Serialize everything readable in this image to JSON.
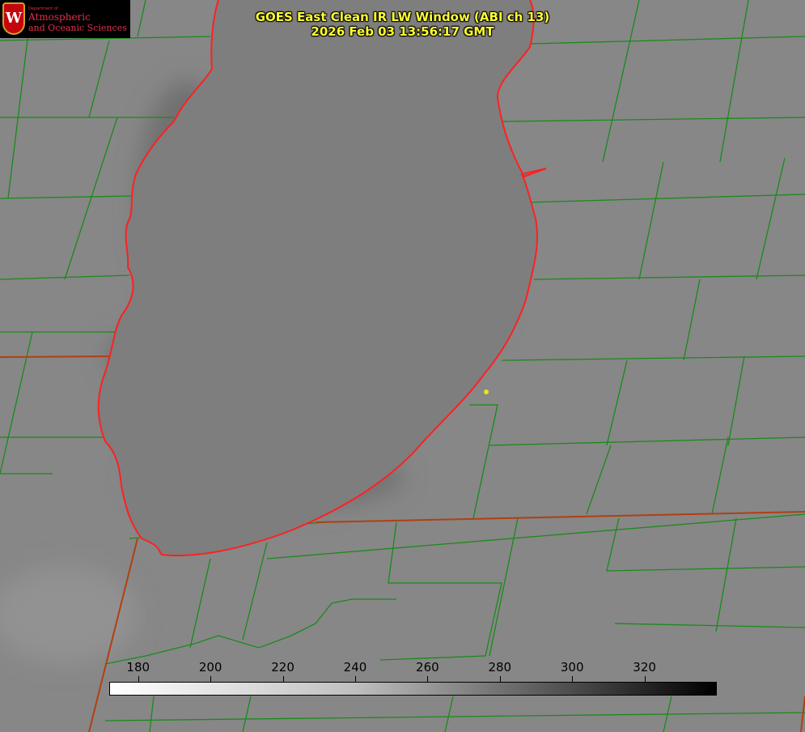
{
  "title": {
    "line1": "GOES East Clean IR LW Window (ABI ch 13)",
    "line2": "2026 Feb 03 13:56:17 GMT"
  },
  "logo": {
    "dept": "Department of",
    "line1": "Atmospheric",
    "line2": "and Oceanic Sciences",
    "mark": "W"
  },
  "colorbar": {
    "ticks": [
      "180",
      "200",
      "220",
      "240",
      "260",
      "280",
      "300",
      "320"
    ],
    "tick_values": [
      180,
      200,
      220,
      240,
      260,
      280,
      300,
      320
    ],
    "range": [
      172,
      340
    ],
    "colors": {
      "low": "#ffffff",
      "high": "#000000"
    }
  },
  "colors": {
    "coast": "#ff2020",
    "county": "#1a8a1a",
    "state": "#b04010",
    "marker": "#e8e020"
  }
}
